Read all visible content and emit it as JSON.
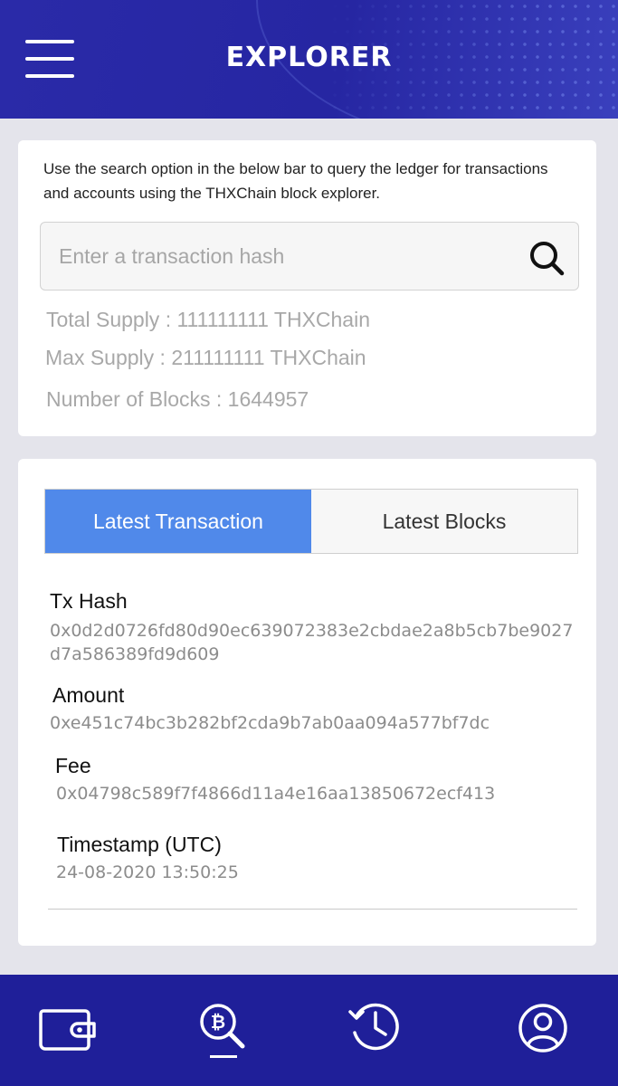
{
  "header": {
    "title": "EXPLORER"
  },
  "explorer": {
    "intro": "Use the search option in the below bar to query the ledger for transactions and accounts using the THXChain block explorer.",
    "search_placeholder": "Enter a transaction hash",
    "search_value": "",
    "total_supply": "Total Supply : 111111111 THXChain",
    "max_supply": "Max Supply : 211111111 THXChain",
    "number_of_blocks": "Number of Blocks : 1644957"
  },
  "tabs": [
    {
      "label": "Latest Transaction",
      "active": true
    },
    {
      "label": "Latest Blocks",
      "active": false
    }
  ],
  "transaction": {
    "tx_hash_label": "Tx Hash",
    "tx_hash": "0x0d2d0726fd80d90ec639072383e2cbdae2a8b5cb7be9027d7a586389fd9d609",
    "amount_label": "Amount",
    "amount": "0xe451c74bc3b282bf2cda9b7ab0aa094a577bf7dc",
    "fee_label": "Fee",
    "fee": "0x04798c589f7f4866d11a4e16aa13850672ecf413",
    "timestamp_label": "Timestamp (UTC)",
    "timestamp": "24-08-2020 13:50:25"
  },
  "bottom_nav": {
    "items": [
      "wallet-icon",
      "bitcoin-search-icon",
      "history-icon",
      "profile-icon"
    ],
    "active_index": 1
  },
  "colors": {
    "header": "#2a2aa8",
    "bottom_nav": "#1f1f99",
    "active_tab": "#5089ea"
  }
}
